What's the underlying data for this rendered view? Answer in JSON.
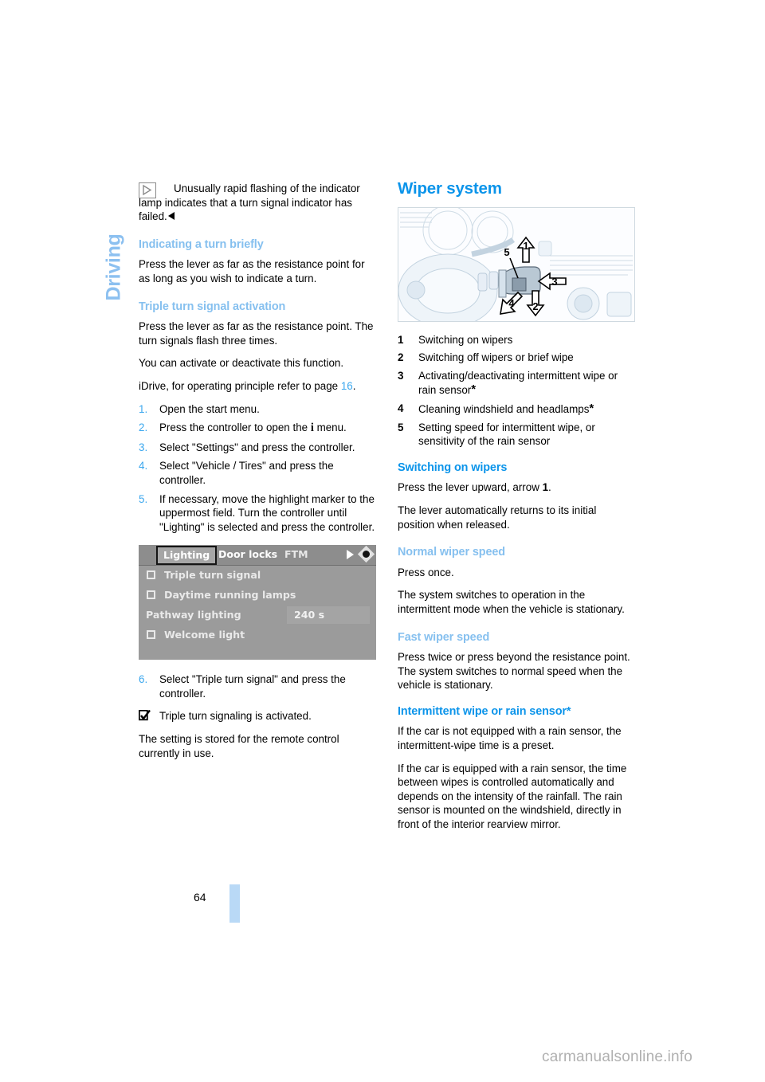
{
  "chapter_tab": {
    "label": "Driving"
  },
  "folio": {
    "page_number": "64"
  },
  "watermark": {
    "text": "carmanualsonline.info"
  },
  "left_column": {
    "note": {
      "icon": "play-triangle-box-icon",
      "text": "Unusually rapid flashing of the indicator lamp indicates that a turn signal indicator has failed."
    },
    "section_indicating": {
      "heading": "Indicating a turn briefly",
      "paragraph": "Press the lever as far as the resistance point for as long as you wish to indicate a turn."
    },
    "section_triple": {
      "heading": "Triple turn signal activation",
      "p1": "Press the lever as far as the resistance point. The turn signals flash three times.",
      "p2": "You can activate or deactivate this function.",
      "p3_before": "iDrive, for operating principle refer to page ",
      "p3_ref": "16",
      "p3_after": ".",
      "steps": [
        {
          "num": "1.",
          "text": "Open the start menu."
        },
        {
          "num": "2.",
          "text_before": "Press the controller to open the ",
          "glyph": "i",
          "text_after": " menu."
        },
        {
          "num": "3.",
          "text": "Select \"Settings\" and press the controller."
        },
        {
          "num": "4.",
          "text": "Select \"Vehicle / Tires\" and press the controller."
        },
        {
          "num": "5.",
          "text": "If necessary, move the highlight marker to the uppermost field. Turn the controller until \"Lighting\" is selected and press the controller."
        }
      ],
      "step6": {
        "num": "6.",
        "text": "Select \"Triple turn signal\" and press the controller."
      },
      "result": {
        "icon": "checked-checkbox-icon",
        "text": "Triple turn signaling is activated."
      },
      "closing": "The setting is stored for the remote control currently in use."
    },
    "idrive_screenshot": {
      "name": "idrive-lighting-menu-screenshot",
      "tabs": [
        {
          "label": "Lighting",
          "selected": true
        },
        {
          "label": "Door locks",
          "selected": false
        },
        {
          "label": "FTM",
          "selected": false
        }
      ],
      "right_icons": [
        "right-arrow-icon",
        "diamond-controller-icon"
      ],
      "rows": [
        {
          "checkbox": true,
          "label": "Triple turn signal",
          "value": ""
        },
        {
          "checkbox": true,
          "label": "Daytime running lamps",
          "value": ""
        },
        {
          "checkbox": false,
          "label": "Pathway lighting",
          "value": "240 s"
        },
        {
          "checkbox": true,
          "label": "Welcome light",
          "value": ""
        }
      ]
    }
  },
  "right_column": {
    "title": "Wiper system",
    "photo": {
      "name": "wiper-stalk-diagram",
      "callouts": [
        "1",
        "2",
        "3",
        "4",
        "5"
      ]
    },
    "legend": [
      {
        "num": "1",
        "text": "Switching on wipers",
        "star": false
      },
      {
        "num": "2",
        "text": "Switching off wipers or brief wipe",
        "star": false
      },
      {
        "num": "3",
        "text": "Activating/deactivating intermittent wipe or rain sensor",
        "star": true
      },
      {
        "num": "4",
        "text": "Cleaning windshield and headlamps",
        "star": true
      },
      {
        "num": "5",
        "text": "Setting speed for intermittent wipe, or sensitivity of the rain sensor",
        "star": false
      }
    ],
    "section_switching": {
      "heading": "Switching on wipers",
      "p1_before": "Press the lever upward, arrow ",
      "p1_bold": "1",
      "p1_after": ".",
      "p2": "The lever automatically returns to its initial position when released."
    },
    "section_normal": {
      "heading": "Normal wiper speed",
      "p1": "Press once.",
      "p2": "The system switches to operation in the intermittent mode when the vehicle is stationary."
    },
    "section_fast": {
      "heading": "Fast wiper speed",
      "p1": "Press twice or press beyond the resistance point.",
      "p2": "The system switches to normal speed when the vehicle is stationary."
    },
    "section_intermittent": {
      "heading": "Intermittent wipe or rain sensor*",
      "p1": "If the car is not equipped with a rain sensor, the intermittent-wipe time is a preset.",
      "p2": "If the car is equipped with a rain sensor, the time between wipes is controlled automatically and depends on the intensity of the rainfall. The rain sensor is mounted on the windshield, directly in front of the interior rearview mirror."
    }
  },
  "colors": {
    "heading_blue": "#0b94ea",
    "subheading_blue": "#86c0ef",
    "tab_blue": "#8cc0f0",
    "folio_bar_blue": "#b9d9f6"
  }
}
